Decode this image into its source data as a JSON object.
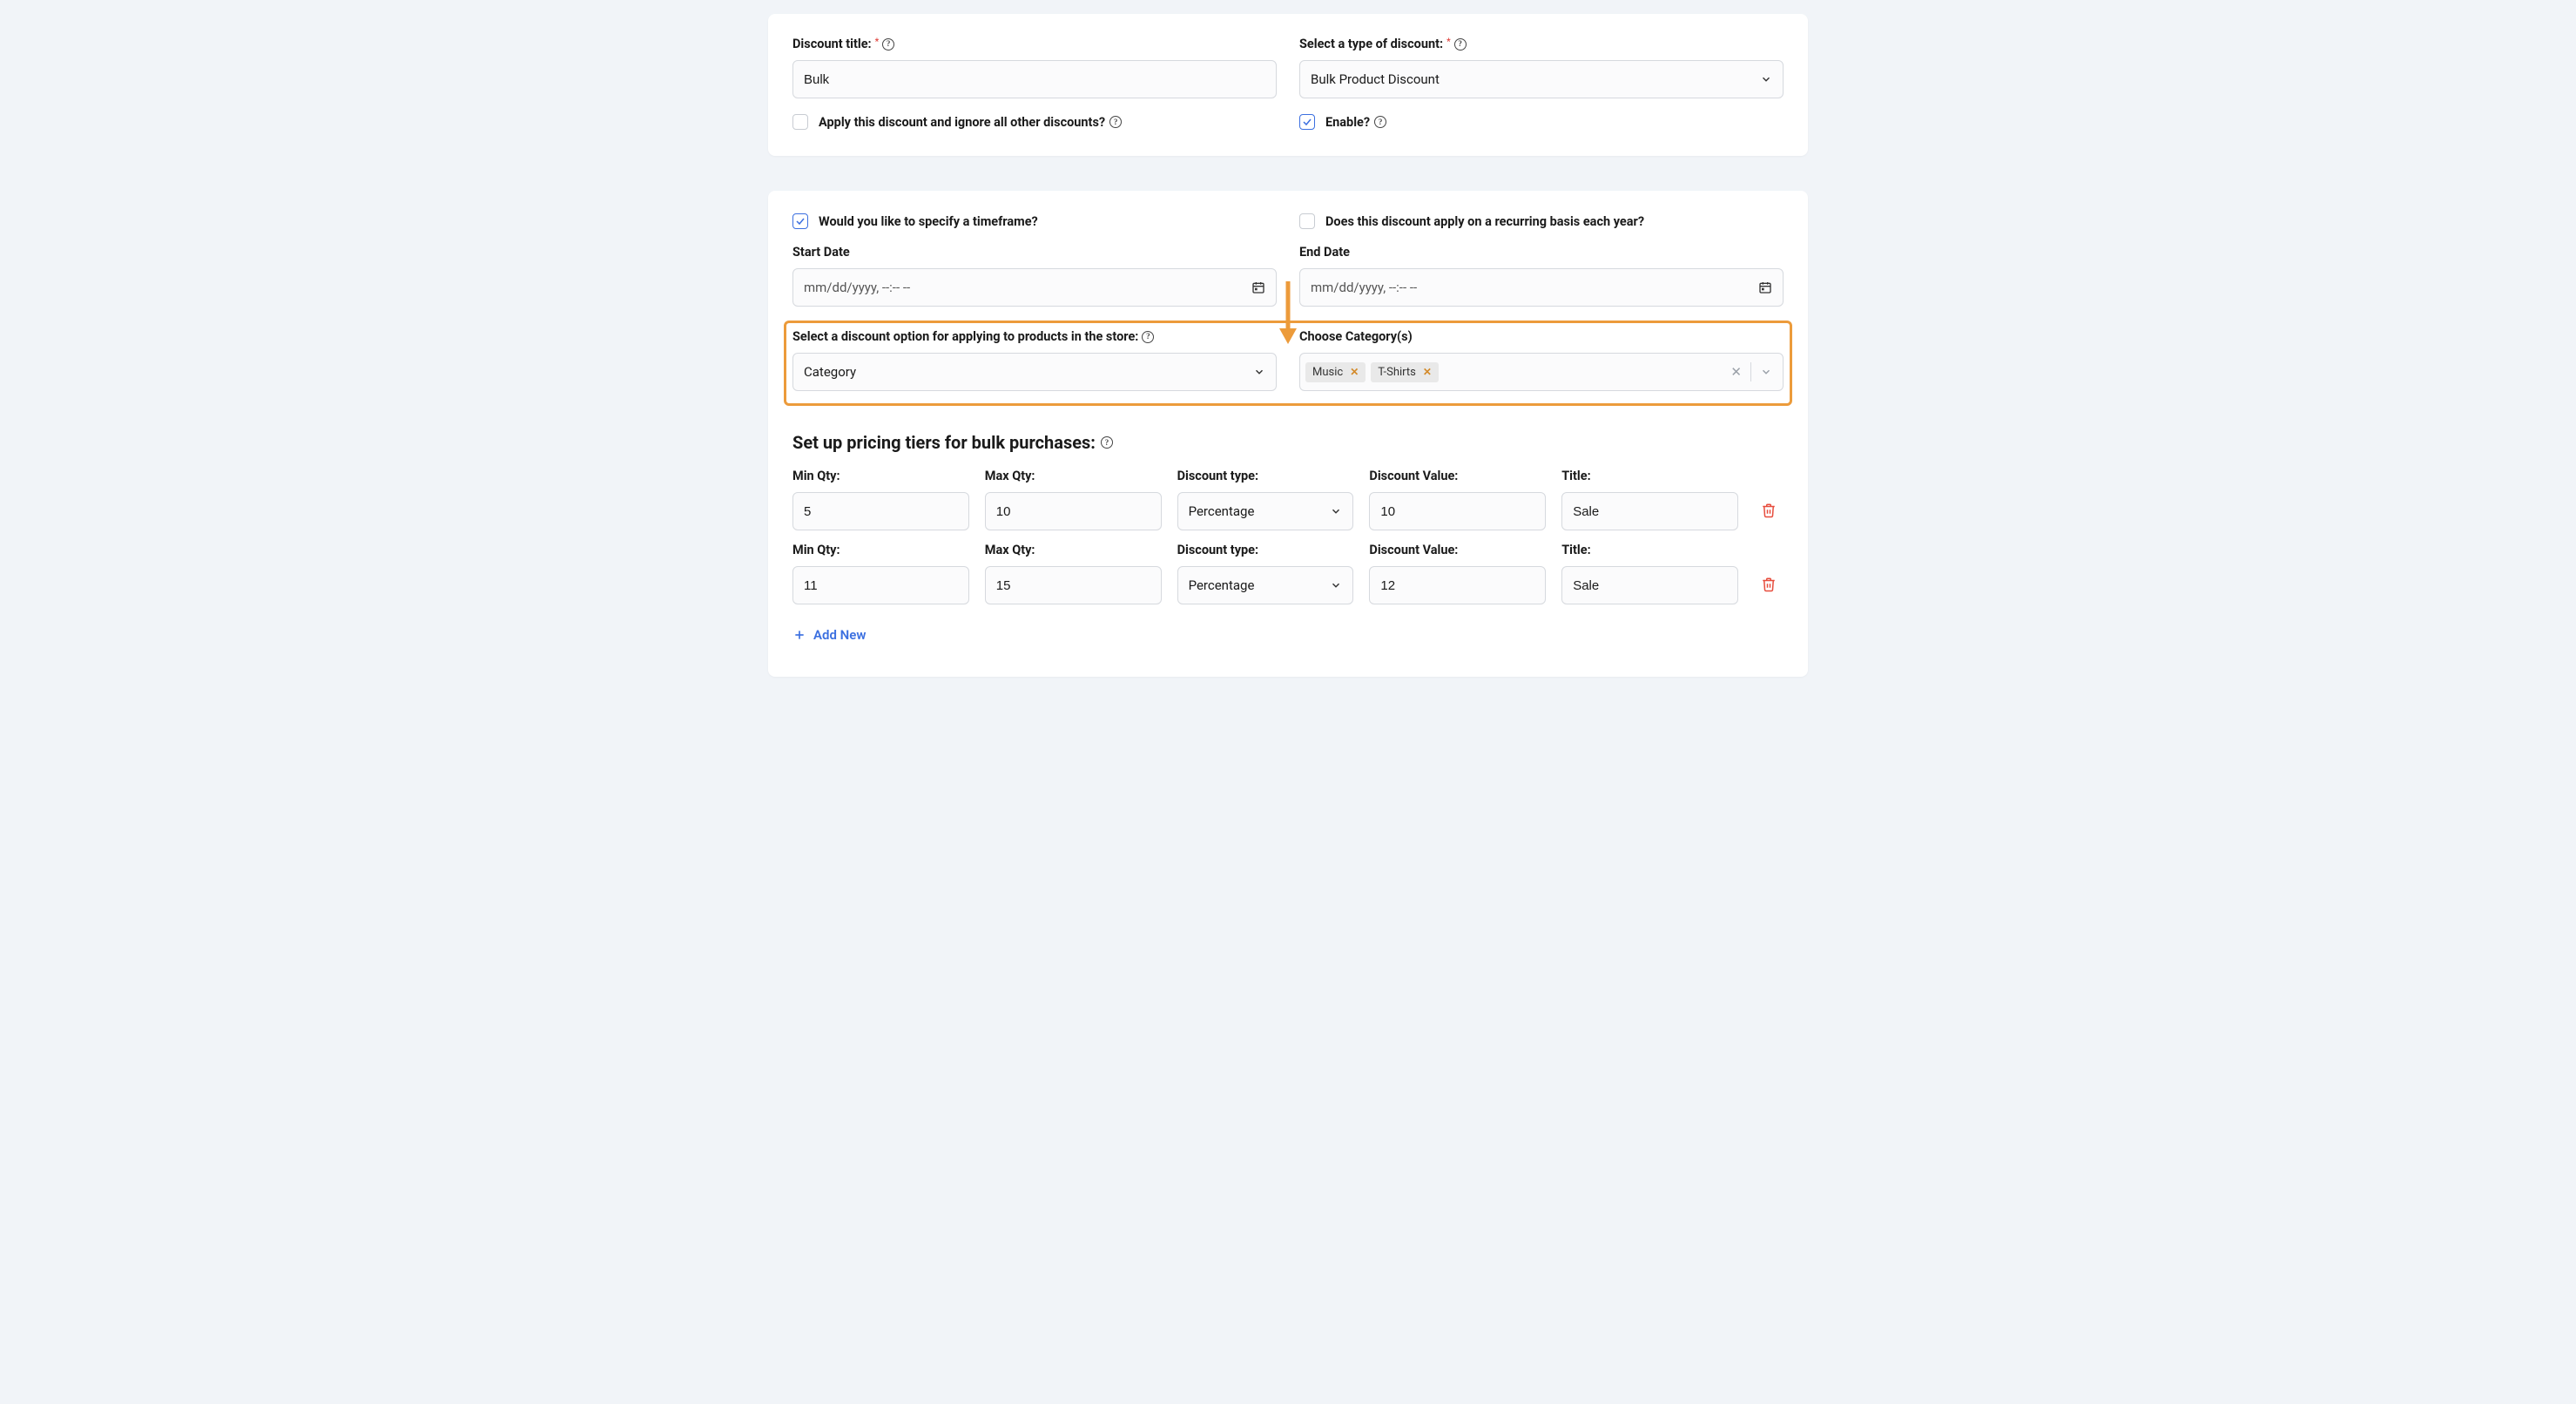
{
  "card1": {
    "discountTitle": {
      "label": "Discount title:",
      "value": "Bulk"
    },
    "discountType": {
      "label": "Select a type of discount:",
      "value": "Bulk Product Discount"
    },
    "ignoreOthers": {
      "label": "Apply this discount and ignore all other discounts?",
      "checked": false
    },
    "enable": {
      "label": "Enable?",
      "checked": true
    }
  },
  "card2": {
    "timeframe": {
      "label": "Would you like to specify a timeframe?",
      "checked": true
    },
    "recurring": {
      "label": "Does this discount apply on a recurring basis each year?",
      "checked": false
    },
    "startDate": {
      "label": "Start Date",
      "placeholder": "mm/dd/yyyy, --:-- --"
    },
    "endDate": {
      "label": "End Date",
      "placeholder": "mm/dd/yyyy, --:-- --"
    },
    "discountOption": {
      "label": "Select a discount option for applying to products in the store:",
      "value": "Category"
    },
    "categories": {
      "label": "Choose Category(s)",
      "values": [
        "Music",
        "T-Shirts"
      ]
    },
    "tiersHeading": "Set up pricing tiers for bulk purchases:",
    "tierLabels": {
      "minQty": "Min Qty:",
      "maxQty": "Max Qty:",
      "discountType": "Discount type:",
      "discountValue": "Discount Value:",
      "title": "Title:"
    },
    "tiers": [
      {
        "min": "5",
        "max": "10",
        "type": "Percentage",
        "value": "10",
        "title": "Sale"
      },
      {
        "min": "11",
        "max": "15",
        "type": "Percentage",
        "value": "12",
        "title": "Sale"
      }
    ],
    "addNew": "Add New"
  }
}
